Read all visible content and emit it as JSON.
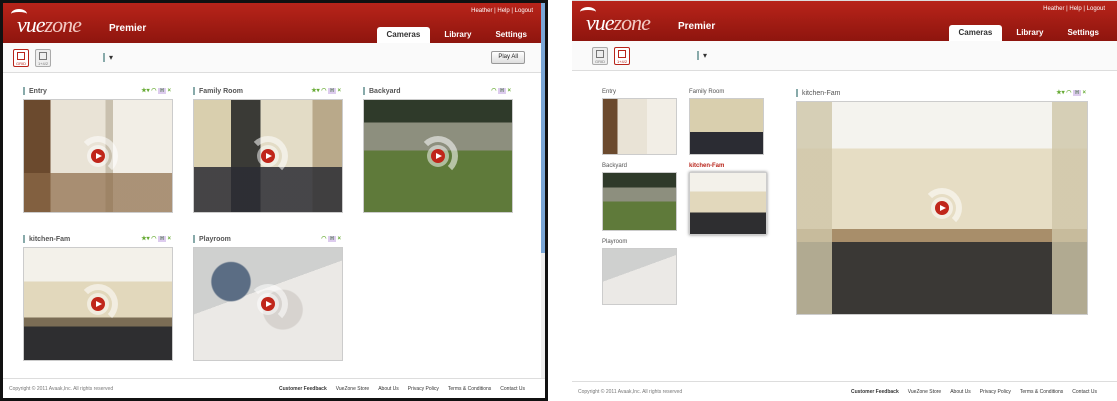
{
  "app": {
    "logo_vue": "vue",
    "logo_zone": "zone",
    "product": "Premier"
  },
  "user": {
    "name": "Heather",
    "help": "Help",
    "logout": "Logout",
    "sep": "|"
  },
  "tabs": [
    {
      "label": "Cameras",
      "active": true
    },
    {
      "label": "Library",
      "active": false
    },
    {
      "label": "Settings",
      "active": false
    }
  ],
  "toolbar": {
    "view_grid_label": "GRID",
    "view_single_label": "1+4/2",
    "play_all": "Play All",
    "dropdown_arrow": "▾"
  },
  "left_panel": {
    "cameras": [
      {
        "name": "Entry",
        "motion": "★▾",
        "wifi": "◠",
        "signal": "H",
        "close": "×"
      },
      {
        "name": "Family Room",
        "motion": "★▾",
        "wifi": "◠",
        "signal": "H",
        "close": "×"
      },
      {
        "name": "Backyard",
        "motion": "",
        "wifi": "◠",
        "signal": "H",
        "close": "×"
      },
      {
        "name": "kitchen-Fam",
        "motion": "★▾",
        "wifi": "◠",
        "signal": "H",
        "close": "×"
      },
      {
        "name": "Playroom",
        "motion": "",
        "wifi": "◠",
        "signal": "H",
        "close": "×"
      }
    ]
  },
  "right_panel": {
    "thumbs": [
      {
        "name": "Entry"
      },
      {
        "name": "Family Room"
      },
      {
        "name": "Backyard"
      },
      {
        "name": "kitchen-Fam",
        "selected": true
      },
      {
        "name": "Playroom"
      }
    ],
    "main": {
      "name": "kitchen-Fam",
      "motion": "★▾",
      "wifi": "◠",
      "signal": "H",
      "close": "×"
    }
  },
  "footer": {
    "copyright": "Copyright © 2011 Avaak,Inc. All rights reserved",
    "links": [
      "Customer Feedback",
      "VueZone Store",
      "About Us",
      "Privacy Policy",
      "Terms & Conditions",
      "Contact Us"
    ]
  },
  "colors": {
    "brand_red": "#b8241a",
    "accent_blue": "#7aa6d6"
  }
}
